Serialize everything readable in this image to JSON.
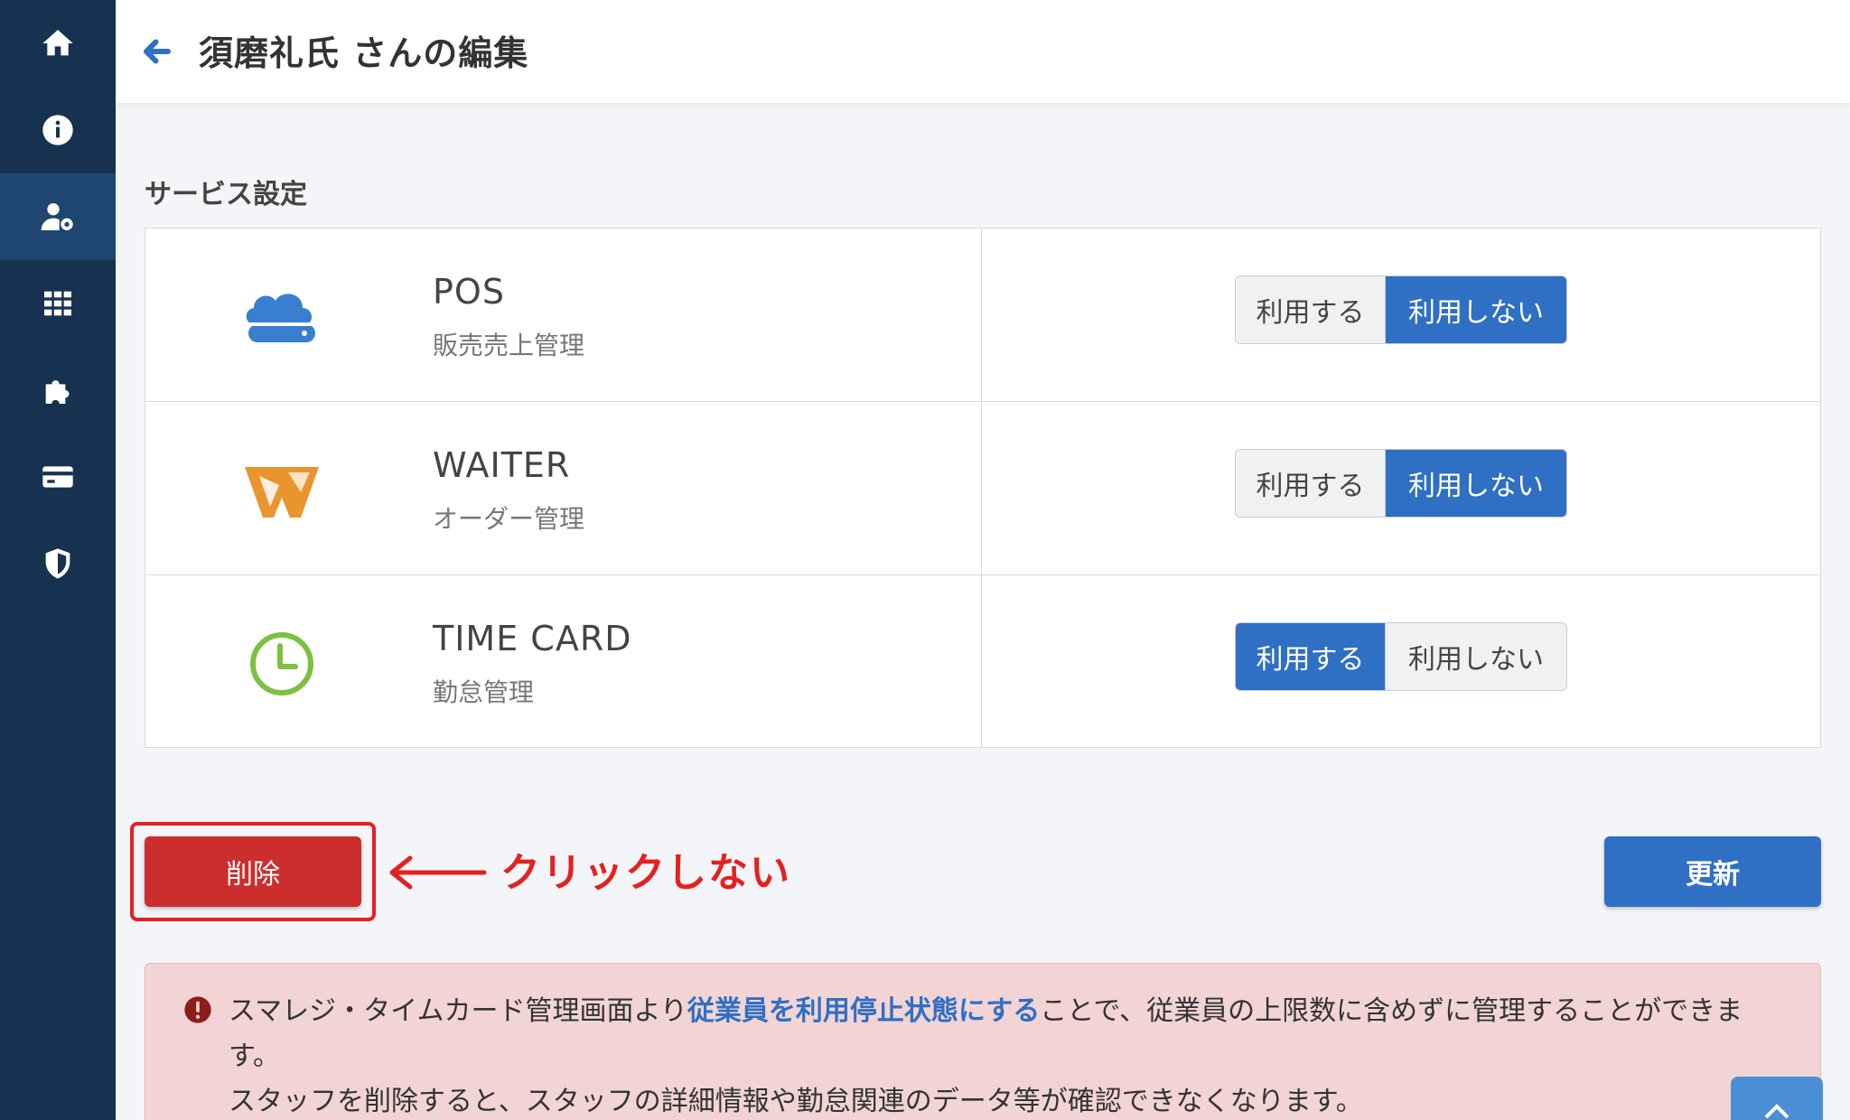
{
  "header": {
    "title": "須磨礼氏 さんの編集"
  },
  "sidebar": {
    "items": [
      {
        "icon": "home-icon"
      },
      {
        "icon": "info-icon"
      },
      {
        "icon": "user-settings-icon",
        "active": true
      },
      {
        "icon": "grid-icon"
      },
      {
        "icon": "puzzle-icon"
      },
      {
        "icon": "credit-card-icon"
      },
      {
        "icon": "shield-icon"
      }
    ]
  },
  "section": {
    "title": "サービス設定"
  },
  "services": [
    {
      "name": "POS",
      "description": "販売売上管理",
      "icon": "cloud-drive-icon",
      "color": "#3a7ed0",
      "use_label": "利用する",
      "nouse_label": "利用しない",
      "selected": "nouse"
    },
    {
      "name": "WAITER",
      "description": "オーダー管理",
      "icon": "waiter-logo-icon",
      "color": "#e8952e",
      "use_label": "利用する",
      "nouse_label": "利用しない",
      "selected": "nouse"
    },
    {
      "name": "TIME CARD",
      "description": "勤怠管理",
      "icon": "clock-icon",
      "color": "#7cc142",
      "use_label": "利用する",
      "nouse_label": "利用しない",
      "selected": "use"
    }
  ],
  "actions": {
    "delete_label": "削除",
    "update_label": "更新",
    "annotation": "クリックしない"
  },
  "alert": {
    "text_before": "スマレジ・タイムカード管理画面より",
    "link_text": "従業員を利用停止状態にする",
    "text_after": "ことで、従業員の上限数に含めずに管理することができます。",
    "line2": "スタッフを削除すると、スタッフの詳細情報や勤怠関連のデータ等が確認できなくなります。"
  },
  "colors": {
    "sidebar": "#163250",
    "primary": "#2f6fc4",
    "danger": "#cc2d2d",
    "annotation": "#e62020"
  }
}
